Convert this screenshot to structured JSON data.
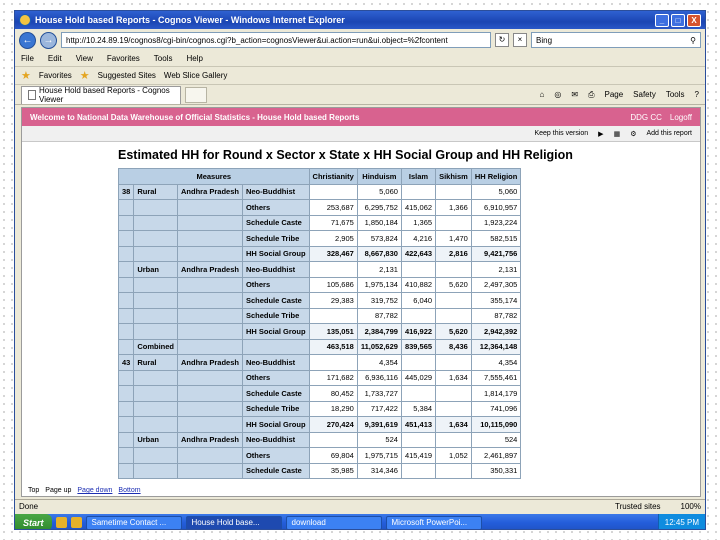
{
  "window": {
    "title": "House Hold based Reports - Cognos Viewer - Windows Internet Explorer",
    "minimize": "_",
    "maximize": "□",
    "close": "X"
  },
  "addressbar": {
    "url": "http://10.24.89.19/cognos8/cgi-bin/cognos.cgi?b_action=cognosViewer&ui.action=run&ui.object=%2fcontent",
    "search_placeholder": "Bing"
  },
  "menu": [
    "File",
    "Edit",
    "View",
    "Favorites",
    "Tools",
    "Help"
  ],
  "favorites": {
    "label": "Favorites",
    "items": [
      "Suggested Sites",
      "Web Slice Gallery"
    ]
  },
  "tab": {
    "label": "House Hold based Reports - Cognos Viewer"
  },
  "commandbar": [
    "Page",
    "Safety",
    "Tools"
  ],
  "cognos": {
    "header_title": "Welcome to National Data Warehouse of Official Statistics - House Hold based Reports",
    "user": "DDG CC",
    "logout": "Logoff",
    "toolbar": {
      "keep_version": "Keep this version",
      "add_report": "Add this report"
    }
  },
  "report": {
    "title": "Estimated HH for Round x Sector x State x HH Social Group and HH Religion",
    "measures_label": "Measures",
    "columns": [
      "Christianity",
      "Hinduism",
      "Islam",
      "Sikhism",
      "HH Religion"
    ],
    "rows": [
      {
        "round": "38",
        "sector": "Rural",
        "state": "Andhra Pradesh",
        "group": "Neo-Buddhist",
        "values": [
          "",
          "5,060",
          "",
          "",
          "5,060"
        ]
      },
      {
        "round": "",
        "sector": "",
        "state": "",
        "group": "Others",
        "values": [
          "253,687",
          "6,295,752",
          "415,062",
          "1,366",
          "6,910,957"
        ]
      },
      {
        "round": "",
        "sector": "",
        "state": "",
        "group": "Schedule Caste",
        "values": [
          "71,675",
          "1,850,184",
          "1,365",
          "",
          "1,923,224"
        ]
      },
      {
        "round": "",
        "sector": "",
        "state": "",
        "group": "Schedule Tribe",
        "values": [
          "2,905",
          "573,824",
          "4,216",
          "1,470",
          "582,515"
        ]
      },
      {
        "round": "",
        "sector": "",
        "state": "",
        "group": "HH Social Group",
        "values": [
          "328,467",
          "8,667,830",
          "422,643",
          "2,816",
          "9,421,756"
        ],
        "summary": true
      },
      {
        "round": "",
        "sector": "Urban",
        "state": "Andhra Pradesh",
        "group": "Neo-Buddhist",
        "values": [
          "",
          "2,131",
          "",
          "",
          "2,131"
        ]
      },
      {
        "round": "",
        "sector": "",
        "state": "",
        "group": "Others",
        "values": [
          "105,686",
          "1,975,134",
          "410,882",
          "5,620",
          "2,497,305"
        ]
      },
      {
        "round": "",
        "sector": "",
        "state": "",
        "group": "Schedule Caste",
        "values": [
          "29,383",
          "319,752",
          "6,040",
          "",
          "355,174"
        ]
      },
      {
        "round": "",
        "sector": "",
        "state": "",
        "group": "Schedule Tribe",
        "values": [
          "",
          "87,782",
          "",
          "",
          "87,782"
        ]
      },
      {
        "round": "",
        "sector": "",
        "state": "",
        "group": "HH Social Group",
        "values": [
          "135,051",
          "2,384,799",
          "416,922",
          "5,620",
          "2,942,392"
        ],
        "summary": true
      },
      {
        "round": "",
        "sector": "Combined",
        "state": "",
        "group": "",
        "values": [
          "463,518",
          "11,052,629",
          "839,565",
          "8,436",
          "12,364,148"
        ],
        "summary": true,
        "combined": true
      },
      {
        "round": "43",
        "sector": "Rural",
        "state": "Andhra Pradesh",
        "group": "Neo-Buddhist",
        "values": [
          "",
          "4,354",
          "",
          "",
          "4,354"
        ]
      },
      {
        "round": "",
        "sector": "",
        "state": "",
        "group": "Others",
        "values": [
          "171,682",
          "6,936,116",
          "445,029",
          "1,634",
          "7,555,461"
        ]
      },
      {
        "round": "",
        "sector": "",
        "state": "",
        "group": "Schedule Caste",
        "values": [
          "80,452",
          "1,733,727",
          "",
          "",
          "1,814,179"
        ]
      },
      {
        "round": "",
        "sector": "",
        "state": "",
        "group": "Schedule Tribe",
        "values": [
          "18,290",
          "717,422",
          "5,384",
          "",
          "741,096"
        ]
      },
      {
        "round": "",
        "sector": "",
        "state": "",
        "group": "HH Social Group",
        "values": [
          "270,424",
          "9,391,619",
          "451,413",
          "1,634",
          "10,115,090"
        ],
        "summary": true
      },
      {
        "round": "",
        "sector": "Urban",
        "state": "Andhra Pradesh",
        "group": "Neo-Buddhist",
        "values": [
          "",
          "524",
          "",
          "",
          "524"
        ]
      },
      {
        "round": "",
        "sector": "",
        "state": "",
        "group": "Others",
        "values": [
          "69,804",
          "1,975,715",
          "415,419",
          "1,052",
          "2,461,897"
        ]
      },
      {
        "round": "",
        "sector": "",
        "state": "",
        "group": "Schedule Caste",
        "values": [
          "35,985",
          "314,346",
          "",
          "",
          "350,331"
        ]
      }
    ]
  },
  "report_footer": {
    "top": "Top",
    "page_up": "Page up",
    "page_down": "Page down",
    "bottom": "Bottom"
  },
  "statusbar": {
    "status": "Done",
    "zone": "Trusted sites",
    "zoom": "100%"
  },
  "taskbar": {
    "start": "Start",
    "buttons": [
      "Sametime Contact ...",
      "House Hold base...",
      "download",
      "Microsoft PowerPoi..."
    ],
    "clock": "12:45 PM"
  }
}
